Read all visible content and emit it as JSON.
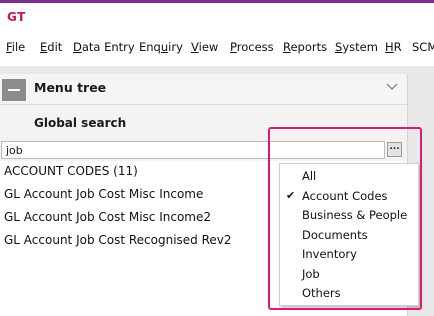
{
  "app": {
    "logo": "GT"
  },
  "menubar": {
    "items": [
      {
        "u": "F",
        "rest": "ile"
      },
      {
        "u": "E",
        "rest": "dit"
      },
      {
        "u": "D",
        "rest": "ata Entry"
      },
      {
        "u": "",
        "rest": "Enq",
        "u2": "u",
        "rest2": "iry"
      },
      {
        "u": "V",
        "rest": "iew"
      },
      {
        "u": "P",
        "rest": "rocess"
      },
      {
        "u": "R",
        "rest": "eports"
      },
      {
        "u": "S",
        "rest": "ystem"
      },
      {
        "u": "H",
        "rest": "R"
      },
      {
        "u": "",
        "rest": "SCM"
      }
    ]
  },
  "menu_tree": {
    "title": "Menu tree"
  },
  "global_search": {
    "title": "Global search",
    "query": "job",
    "more_button": "..."
  },
  "results": [
    "ACCOUNT CODES (11)",
    "GL Account Job Cost Misc Income",
    "GL Account Job Cost Misc Income2",
    "GL Account Job Cost Recognised Rev2"
  ],
  "filter_menu": {
    "checked_index": 1,
    "check_glyph": "✔",
    "items": [
      "All",
      "Account Codes",
      "Business & People",
      "Documents",
      "Inventory",
      "Job",
      "Others"
    ]
  },
  "colors": {
    "accent": "#7b2d8e",
    "logo": "#c2185b",
    "highlight": "#e0187a"
  }
}
